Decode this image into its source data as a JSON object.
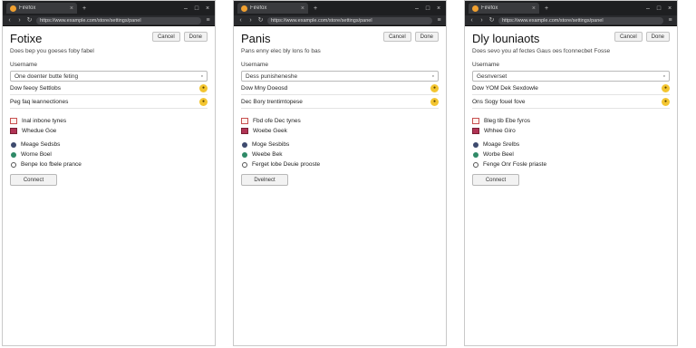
{
  "windows": [
    {
      "tab_title": "Firefox",
      "url": "https://www.example.com/store/settings/panel",
      "title": "Fotixe",
      "header_buttons": [
        "Cancel",
        "Done"
      ],
      "subtitle": "Does bep you goeses foby fabel",
      "field_label": "Username",
      "field_value": "One doenter butte feting",
      "options": [
        "Dow feeoy Settlobs",
        "Peg faq leannectiones"
      ],
      "items_a": [
        "Inal inbone tynes",
        "Whedue Goe"
      ],
      "items_b": [
        "Meage Sedsbs",
        "Worne Boel",
        "Benpe loo fbele prance"
      ],
      "button": "Connect"
    },
    {
      "tab_title": "Firefox",
      "url": "https://www.example.com/store/settings/panel",
      "title": "Panis",
      "header_buttons": [
        "Cancel",
        "Done"
      ],
      "subtitle": "Pans enny elec bly lons fo bas",
      "field_label": "Username",
      "field_value": "Dess punisheneshe",
      "options": [
        "Dow Mny Doeosd",
        "Dec Bory trentimtopese"
      ],
      "items_a": [
        "Fbd ofe Dec tynes",
        "Woebe Geek"
      ],
      "items_b": [
        "Moge Sesbibs",
        "Weebe Bek",
        "Ferget lobe Deuie prooste"
      ],
      "button": "Dvelnect"
    },
    {
      "tab_title": "Firefox",
      "url": "https://www.example.com/store/settings/panel",
      "title": "Dly louniaots",
      "header_buttons": [
        "Cancel",
        "Done"
      ],
      "subtitle": "Does sevo you af fectes Gaus oes fconnecbet Fosse",
      "field_label": "Username",
      "field_value": "Gesnverset",
      "options": [
        "Dow YOM Dek Sexdowle",
        "Ons Sogy fouel fove"
      ],
      "items_a": [
        "Bleg tib Ebe fyros",
        "Whhee Giro"
      ],
      "items_b": [
        "Moage Srelbs",
        "Worbe Beel",
        "Fenge Onr Fosle priaste"
      ],
      "button": "Connect"
    }
  ]
}
